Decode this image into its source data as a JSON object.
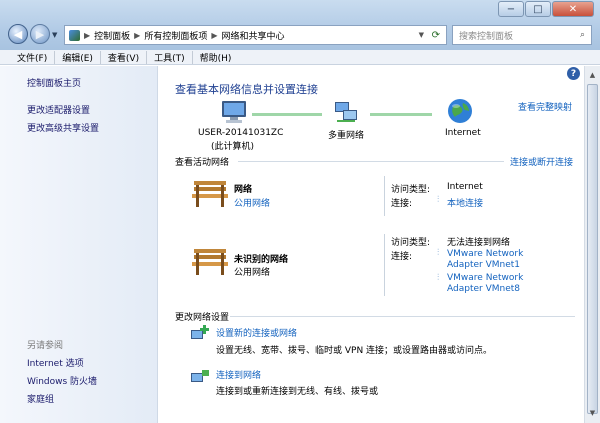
{
  "window": {
    "back_icon": "back-arrow-icon",
    "forward_icon": "forward-arrow-icon",
    "minimize": "−",
    "maximize": "□",
    "close": "✕"
  },
  "address": {
    "crumbs": [
      "控制面板",
      "所有控制面板项",
      "网络和共享中心"
    ],
    "search_placeholder": "搜索控制面板"
  },
  "menu": [
    "文件(F)",
    "编辑(E)",
    "查看(V)",
    "工具(T)",
    "帮助(H)"
  ],
  "sidebar": {
    "home": "控制面板主页",
    "items": [
      "更改适配器设置",
      "更改高级共享设置"
    ],
    "see_also": "另请参阅",
    "see_also_items": [
      "Internet 选项",
      "Windows 防火墙",
      "家庭组"
    ]
  },
  "main": {
    "title": "查看基本网络信息并设置连接",
    "view_full_map": "查看完整映射",
    "map": {
      "computer_name": "USER-20141031ZC",
      "computer_sub": "(此计算机)",
      "middle": "多重网络",
      "internet": "Internet"
    },
    "active_header": "查看活动网络",
    "connect_disconnect": "连接或断开连接",
    "network1": {
      "name": "网络",
      "type": "公用网络",
      "access_label": "访问类型:",
      "access_value": "Internet",
      "conn_label": "连接:",
      "conn_value": "本地连接"
    },
    "network2": {
      "name": "未识别的网络",
      "type": "公用网络",
      "access_label": "访问类型:",
      "access_value": "无法连接到网络",
      "conn_label": "连接:",
      "conn_values": [
        "VMware Network Adapter VMnet1",
        "VMware Network Adapter VMnet8"
      ]
    },
    "change_header": "更改网络设置",
    "tasks": [
      {
        "title": "设置新的连接或网络",
        "desc": "设置无线、宽带、拨号、临时或 VPN 连接；或设置路由器或访问点。"
      },
      {
        "title": "连接到网络",
        "desc": "连接到或重新连接到无线、有线、拨号或"
      }
    ]
  }
}
